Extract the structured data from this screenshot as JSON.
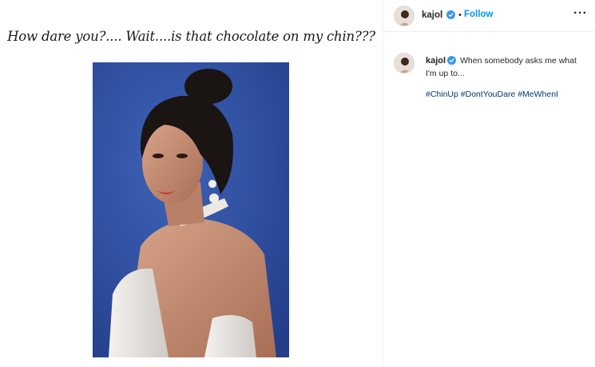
{
  "post": {
    "image_caption_text": "How dare you?.... Wait....is that chocolate on my chin???",
    "author": {
      "username": "kajol",
      "verified": true,
      "separator": "•",
      "follow_label": "Follow"
    },
    "more_label": "···",
    "caption": {
      "username": "kajol",
      "text": "When somebody asks me what I'm up to...",
      "hashtags": [
        "#ChinUp",
        "#DontYouDare",
        "#MeWhenI"
      ]
    }
  },
  "colors": {
    "follow_blue": "#0095f6",
    "verified_blue": "#3897f0",
    "hashtag": "#00376b",
    "photo_background": "#2f4fa0"
  },
  "icons": {
    "verified": "verified-badge-icon",
    "more": "more-options-icon"
  }
}
